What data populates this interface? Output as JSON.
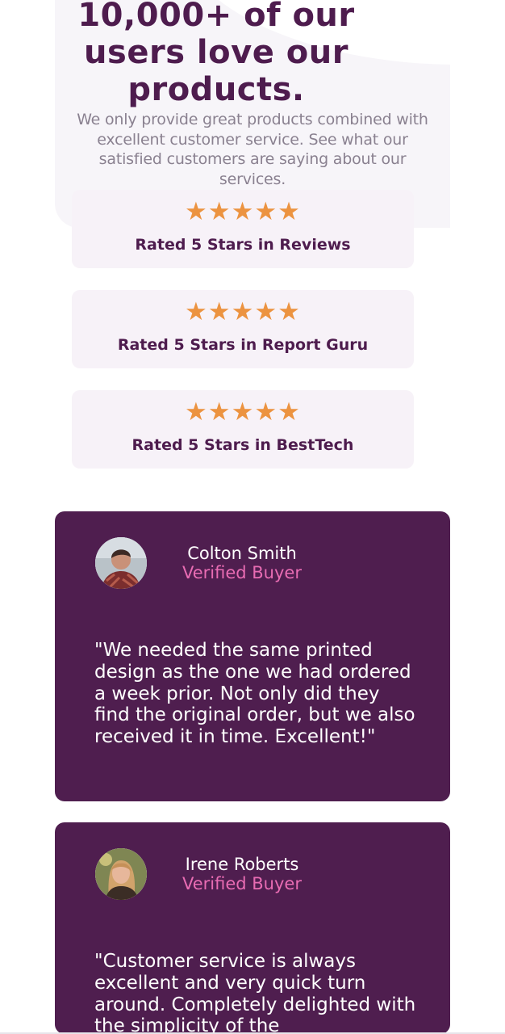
{
  "hero": {
    "title": "10,000+ of our users love our products.",
    "description": "We only provide great products combined with excellent customer service. See what our satisfied customers are saying about our services."
  },
  "ratings": [
    {
      "stars": 5,
      "star_glyphs": "★★★★★",
      "label": "Rated 5 Stars in Reviews"
    },
    {
      "stars": 5,
      "star_glyphs": "★★★★★",
      "label": "Rated 5 Stars in Report Guru"
    },
    {
      "stars": 5,
      "star_glyphs": "★★★★★",
      "label": "Rated 5 Stars in BestTech"
    }
  ],
  "testimonials": [
    {
      "name": "Colton Smith",
      "status": "Verified Buyer",
      "quote": "\"We needed the same printed design as the one we had ordered a week prior. Not only did they find the original order, but we also received it in time. Excellent!\""
    },
    {
      "name": "Irene Roberts",
      "status": "Verified Buyer",
      "quote": "\"Customer service is always excellent and very quick turn around. Completely delighted with the simplicity of the"
    }
  ],
  "colors": {
    "heading": "#4e1c4e",
    "body_text": "#8a8190",
    "star": "#ec9340",
    "card_background": "#f7f2f8",
    "testimonial_background": "#4f1e4f",
    "verified": "#e86cb3"
  },
  "icons": {
    "star": "star-icon",
    "avatar": "person-avatar"
  }
}
